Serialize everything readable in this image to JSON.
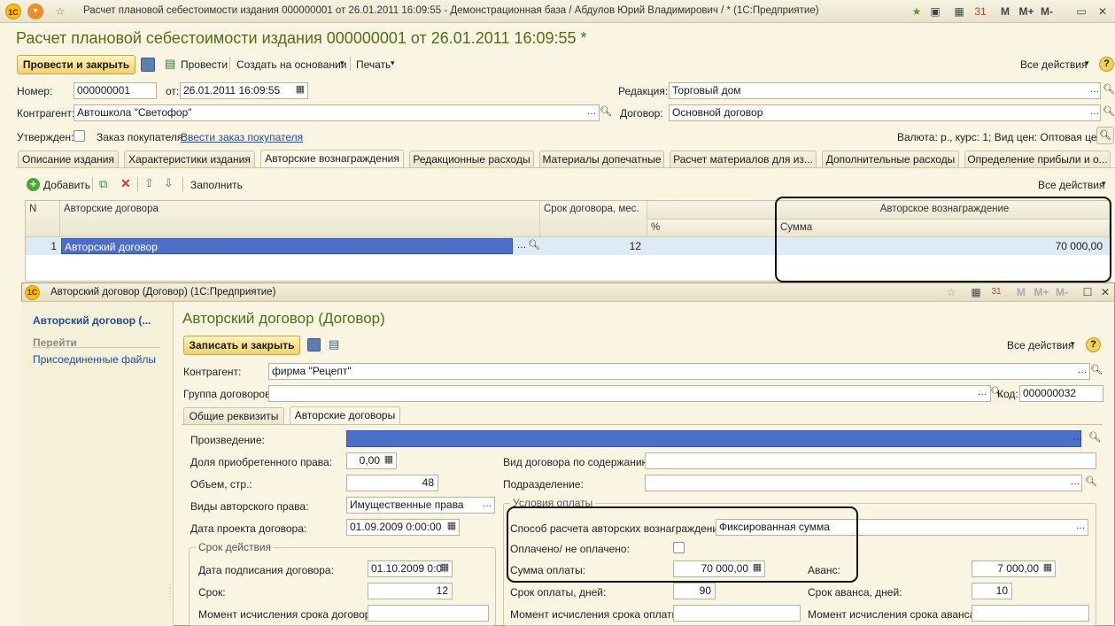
{
  "window": {
    "title": "Расчет плановой себестоимости издания  000000001 от 26.01.2011 16:09:55 - Демонстрационная база / Абдулов Юрий Владимирович / * (1С:Предприятие)",
    "controls": [
      "M",
      "M+",
      "M-"
    ]
  },
  "doc": {
    "heading": "Расчет плановой себестоимости издания  000000001 от 26.01.2011 16:09:55 *",
    "toolbar": {
      "post_close": "Провести и закрыть",
      "post": "Провести",
      "create_based": "Создать на основании",
      "print": "Печать",
      "all_actions": "Все действия"
    },
    "fields": {
      "number_label": "Номер:",
      "number": "000000001",
      "from_label": "от:",
      "date": "26.01.2011 16:09:55",
      "edition_label": "Редакция:",
      "edition": "Торговый дом",
      "counterparty_label": "Контрагент:",
      "counterparty": "Автошкола \"Светофор\"",
      "contract_label": "Договор:",
      "contract": "Основной договор",
      "approved_label": "Утвержден:",
      "order_label": "Заказ покупателя:",
      "order_link": "Ввести заказ покупателя",
      "currency": "Валюта: р., курс: 1; Вид цен: Оптовая цена"
    },
    "tabs": [
      "Описание издания",
      "Характеристики издания",
      "Авторские вознаграждения",
      "Редакционные расходы",
      "Материалы допечатные",
      "Расчет материалов для из...",
      "Дополнительные расходы",
      "Определение прибыли и о..."
    ],
    "table_toolbar": {
      "add": "Добавить",
      "fill": "Заполнить",
      "all_actions": "Все действия"
    },
    "table": {
      "col_n": "N",
      "col_contracts": "Авторские договора",
      "col_term": "Срок договора, мес.",
      "col_pct": "%",
      "col_reward": "Авторское вознаграждение",
      "col_sum": "Сумма",
      "rows": [
        {
          "n": "1",
          "contract": "Авторский договор",
          "term": "12",
          "pct": "",
          "sum": "70 000,00"
        }
      ]
    }
  },
  "contract_form": {
    "window_title": "Авторский договор (Договор)  (1С:Предприятие)",
    "sidebar": {
      "title": "Авторский договор (...",
      "goto": "Перейти",
      "attached": "Присоединенные файлы"
    },
    "heading": "Авторский договор (Договор)",
    "save_close": "Записать и закрыть",
    "all_actions": "Все действия",
    "counterparty_label": "Контрагент:",
    "counterparty": "фирма \"Рецепт\"",
    "group_label": "Группа договоров:",
    "group": "",
    "code_label": "Код:",
    "code": "000000032",
    "tabs": [
      "Общие реквизиты",
      "Авторские договоры"
    ],
    "work_label": "Произведение:",
    "share_label": "Доля приобретенного права:",
    "share": "0,00",
    "volume_label": "Объем, стр.:",
    "volume": "48",
    "rights_label": "Виды авторского права:",
    "rights": "Имущественные права",
    "draft_date_label": "Дата проекта договора:",
    "draft_date": "01.09.2009  0:00:00",
    "term_group": "Срок действия",
    "sign_date_label": "Дата подписания договора:",
    "sign_date": "01.10.2009  0:0",
    "term_label": "Срок:",
    "term": "12",
    "term_calc_label": "Момент исчисления срока договора:",
    "kind_label": "Вид договора по содержанию:",
    "division_label": "Подразделение:",
    "pay_group": "Условия оплаты",
    "method_label": "Способ расчета авторских вознаграждений:",
    "method": "Фиксированная сумма",
    "paid_label": "Оплачено/ не оплачено:",
    "amount_label": "Сумма оплаты:",
    "amount": "70 000,00",
    "advance_label": "Аванс:",
    "advance": "7 000,00",
    "pay_days_label": "Срок оплаты, дней:",
    "pay_days": "90",
    "adv_days_label": "Срок аванса, дней:",
    "adv_days": "10",
    "pay_calc_label": "Момент исчисления срока оплаты:",
    "adv_calc_label": "Момент исчисления срока аванса:"
  }
}
